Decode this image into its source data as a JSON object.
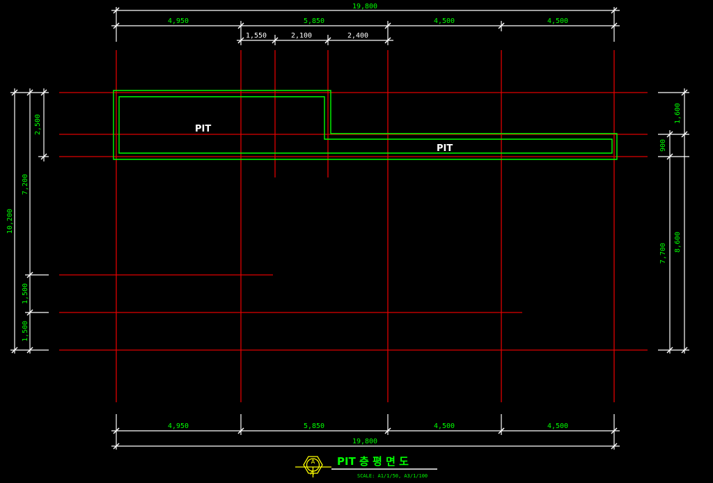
{
  "dims": {
    "top_total": "19,800",
    "top_bays": [
      "4,950",
      "5,850",
      "4,500",
      "4,500"
    ],
    "top_sub": [
      "1,550",
      "2,100",
      "2,400"
    ],
    "bottom_bays": [
      "4,950",
      "5,850",
      "4,500",
      "4,500"
    ],
    "bottom_total": "19,800",
    "left_total": "10,200",
    "left_mid": [
      "7,200",
      "1,500",
      "1,500"
    ],
    "left_inner": "2,500",
    "right_upper": [
      "1,600",
      "900"
    ],
    "right_lower": "8,600",
    "right_inner": "7,700"
  },
  "pit_labels": [
    "PIT",
    "PIT"
  ],
  "title": {
    "text": "PIT 층 평 면 도",
    "scale": "SCALE: A1/1/50, A3/1/100",
    "symbol_top": "A",
    "symbol_bottom": "A-"
  },
  "colors": {
    "background": "#000000",
    "grid_line": "#e00000",
    "dimension_line": "#ffffff",
    "dimension_text": "#00ff00",
    "pit_outline": "#00ff00",
    "symbol": "#ffff00"
  }
}
